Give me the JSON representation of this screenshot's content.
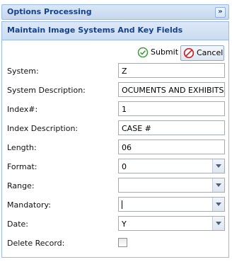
{
  "window": {
    "title": "Options Processing",
    "collapse_glyph": "»"
  },
  "panel": {
    "title": "Maintain Image Systems And Key Fields"
  },
  "toolbar": {
    "submit_label": "Submit",
    "cancel_label": "Cancel"
  },
  "form": {
    "system_label": "System:",
    "system_value": "Z",
    "system_description_label": "System Description:",
    "system_description_value": "OCUMENTS AND EXHIBITS",
    "index_number_label": "Index#:",
    "index_number_value": "1",
    "index_description_label": "Index Description:",
    "index_description_value": "CASE #",
    "length_label": "Length:",
    "length_value": "06",
    "format_label": "Format:",
    "format_value": "0",
    "range_label": "Range:",
    "range_value": "",
    "mandatory_label": "Mandatory:",
    "mandatory_value": "",
    "date_label": "Date:",
    "date_value": "Y",
    "delete_record_label": "Delete Record:",
    "delete_record_checked": false
  },
  "colors": {
    "header_text": "#15428b",
    "border": "#99bbe8",
    "submit_icon": "#3c9a3c",
    "cancel_icon": "#d02020"
  }
}
